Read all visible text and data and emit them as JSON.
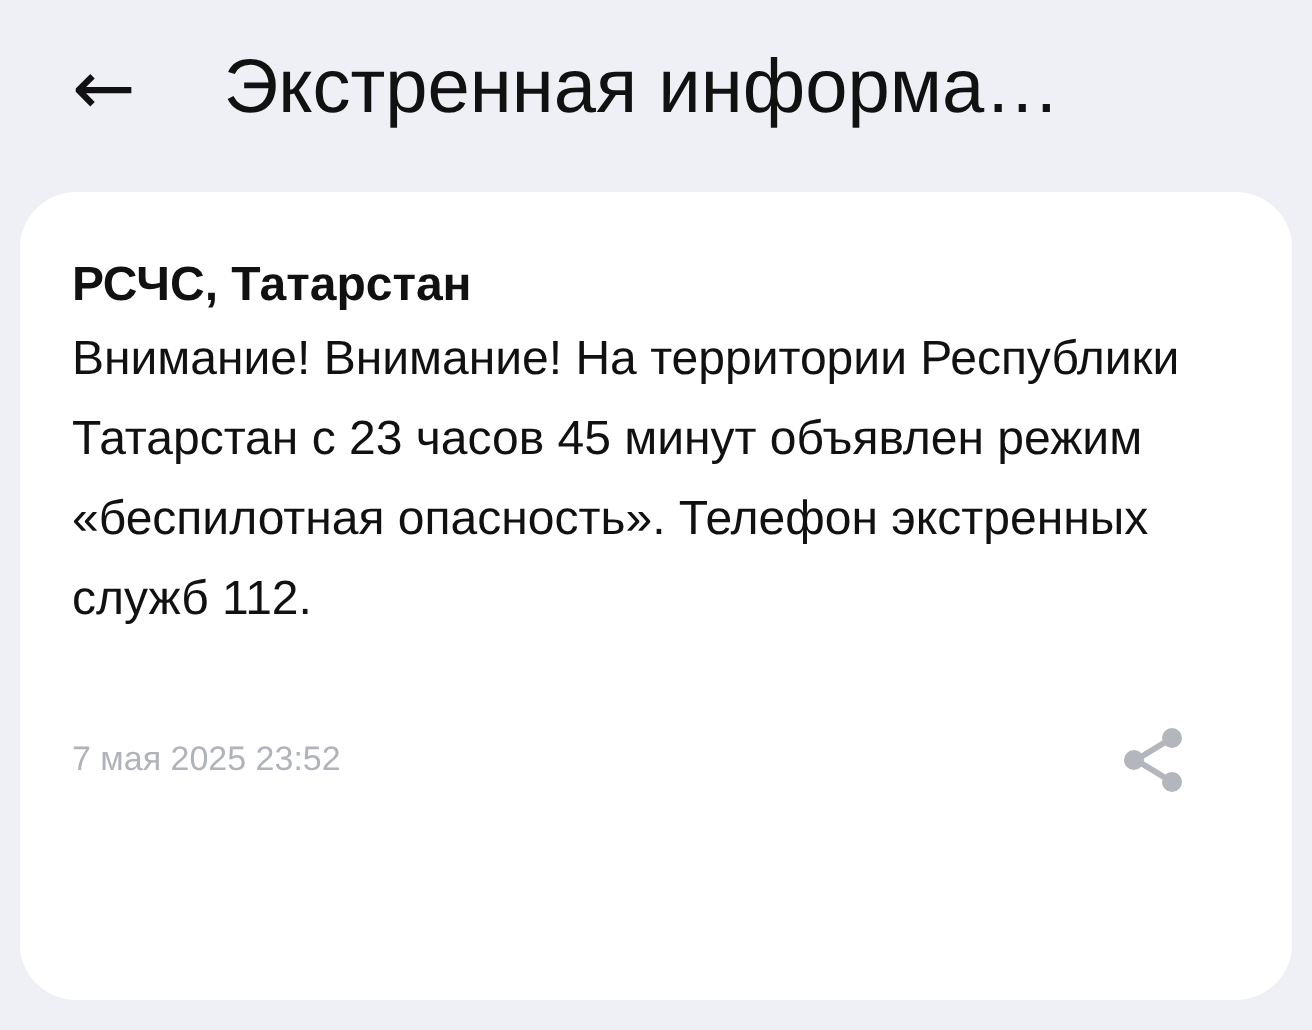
{
  "header": {
    "back": "←",
    "title": "Экстренная информа…"
  },
  "message": {
    "sender": "РСЧС, Татарстан",
    "text": "Внимание! Внимание! На территории Республики Татарстан с 23 часов 45 минут объявлен режим «беспилотная опасность». Телефон экстренных служб 112.",
    "date": "7 мая 2025 23:52"
  }
}
